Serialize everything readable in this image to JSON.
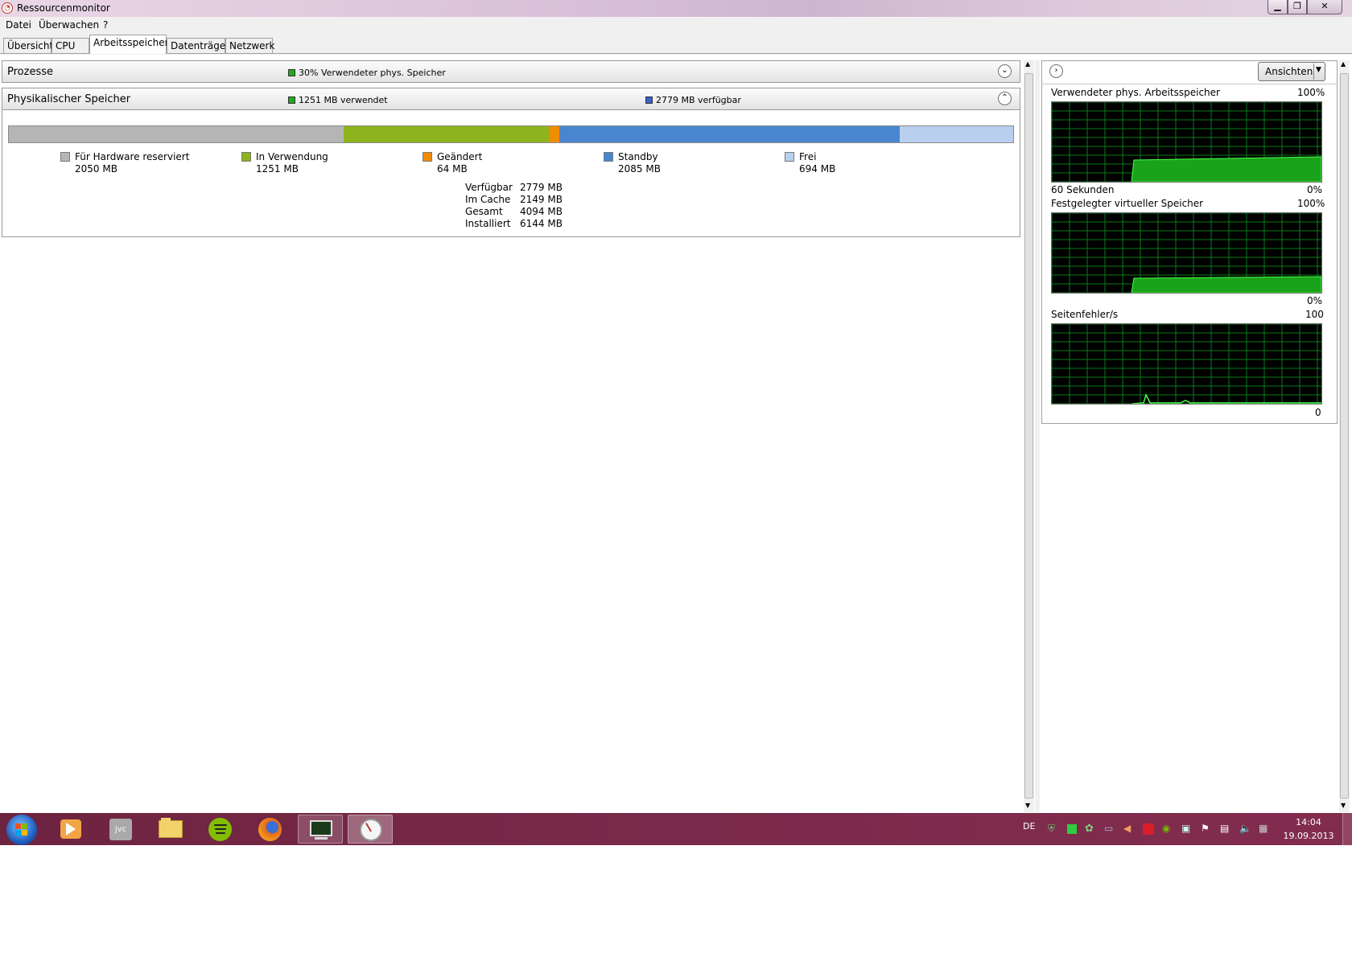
{
  "window": {
    "title": "Ressourcenmonitor"
  },
  "menu": [
    "Datei",
    "Überwachen",
    "?"
  ],
  "tabs": [
    "Übersicht",
    "CPU",
    "Arbeitsspeicher",
    "Datenträger",
    "Netzwerk"
  ],
  "active_tab": "Arbeitsspeicher",
  "processes_section": {
    "title": "Prozesse",
    "info": "30% Verwendeter phys. Speicher",
    "info_color": "#1faa1f"
  },
  "physical_section": {
    "title": "Physikalischer Speicher",
    "used_info": "1251 MB verwendet",
    "available_info": "2779 MB verfügbar",
    "segments": [
      {
        "label": "Für Hardware reserviert",
        "value": "2050 MB",
        "mb": 2050,
        "color": "#b5b5b5"
      },
      {
        "label": "In Verwendung",
        "value": "1251 MB",
        "mb": 1251,
        "color": "#8db41c"
      },
      {
        "label": "Geändert",
        "value": "64 MB",
        "mb": 64,
        "color": "#f08c00"
      },
      {
        "label": "Standby",
        "value": "2085 MB",
        "mb": 2085,
        "color": "#4a86cf"
      },
      {
        "label": "Frei",
        "value": "694 MB",
        "mb": 694,
        "color": "#b8cff0"
      }
    ],
    "stats": [
      {
        "label": "Verfügbar",
        "value": "2779 MB"
      },
      {
        "label": "Im Cache",
        "value": "2149 MB"
      },
      {
        "label": "Gesamt",
        "value": "4094 MB"
      },
      {
        "label": "Installiert",
        "value": "6144 MB"
      }
    ]
  },
  "right_panel": {
    "views_button": "Ansichten",
    "graphs": [
      {
        "title": "Verwendeter phys. Arbeitsspeicher",
        "max": "100%",
        "min": "0%",
        "time_label": "60 Sekunden"
      },
      {
        "title": "Festgelegter virtueller Speicher",
        "max": "100%",
        "min": "0%"
      },
      {
        "title": "Seitenfehler/s",
        "max": "100",
        "min": "0"
      }
    ]
  },
  "taskbar": {
    "apps": [
      "start-orb-icon",
      "media-player-icon",
      "jvc-app-icon",
      "file-explorer-icon",
      "spotify-icon",
      "firefox-icon",
      "performance-monitor-icon",
      "resource-monitor-icon"
    ],
    "language": "DE",
    "time": "14:04",
    "date": "19.09.2013"
  }
}
